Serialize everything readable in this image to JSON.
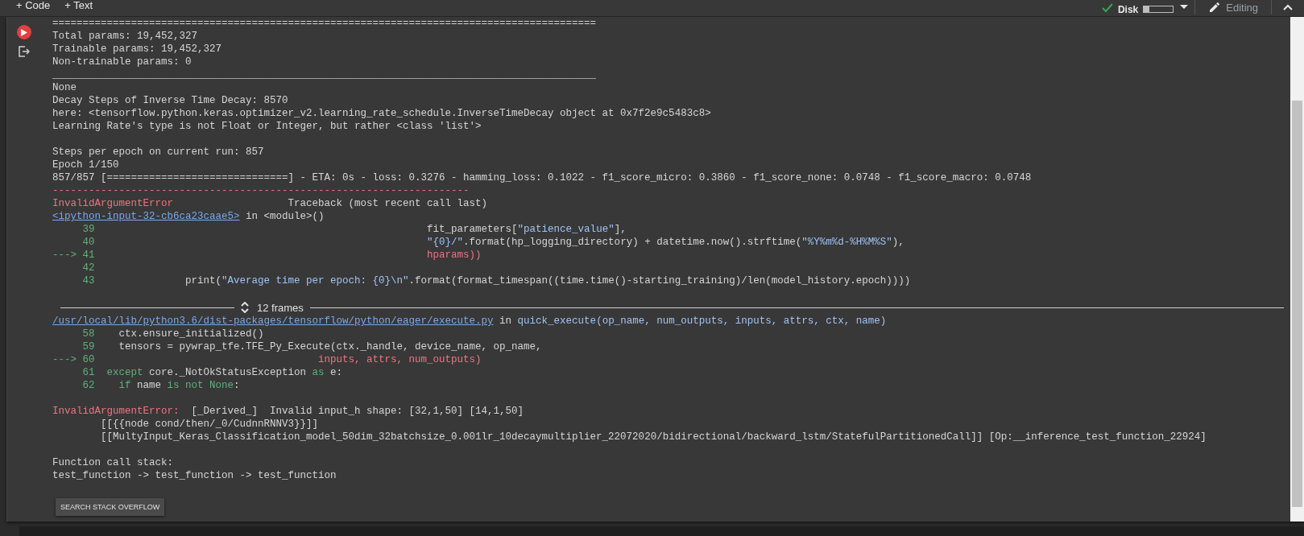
{
  "toolbar": {
    "add_buttons": [
      "+ Code",
      "+ Text"
    ],
    "status": {
      "connected": true,
      "disk": {
        "label": "Disk",
        "level": 0.2
      }
    },
    "mode": {
      "label": "Editing"
    }
  },
  "cell": {
    "output": [
      {
        "kind": "text",
        "segments": [
          {
            "text": "=========================================================================================="
          }
        ]
      },
      {
        "kind": "text",
        "segments": [
          {
            "text": "Total params: 19,452,327"
          }
        ]
      },
      {
        "kind": "text",
        "segments": [
          {
            "text": "Trainable params: 19,452,327"
          }
        ]
      },
      {
        "kind": "text",
        "segments": [
          {
            "text": "Non-trainable params: 0"
          }
        ]
      },
      {
        "kind": "text",
        "segments": [
          {
            "text": "__________________________________________________________________________________________"
          }
        ]
      },
      {
        "kind": "text",
        "segments": [
          {
            "text": "None"
          }
        ]
      },
      {
        "kind": "text",
        "segments": [
          {
            "text": "Decay Steps of Inverse Time Decay: 8570"
          }
        ]
      },
      {
        "kind": "text",
        "segments": [
          {
            "text": "here: <tensorflow.python.keras.optimizer_v2.learning_rate_schedule.InverseTimeDecay object at 0x7f2e9c5483c8>"
          }
        ]
      },
      {
        "kind": "text",
        "segments": [
          {
            "text": "Learning Rate's type is not Float or Integer, but rather <class 'list'>"
          }
        ]
      },
      {
        "kind": "blank"
      },
      {
        "kind": "text",
        "segments": [
          {
            "text": "Steps per epoch on current run: 857"
          }
        ]
      },
      {
        "kind": "text",
        "segments": [
          {
            "text": "Epoch 1/150"
          }
        ]
      },
      {
        "kind": "text",
        "segments": [
          {
            "text": "857/857 [==============================] - ETA: 0s - loss: 0.3276 - hamming_loss: 0.1022 - f1_score_micro: 0.3860 - f1_score_none: 0.0748 - f1_score_macro: 0.0748"
          }
        ]
      },
      {
        "kind": "text",
        "segments": [
          {
            "text": "---------------------------------------------------------------------",
            "kind": "error"
          }
        ]
      },
      {
        "kind": "text",
        "segments": [
          {
            "text": "InvalidArgumentError",
            "kind": "error"
          },
          {
            "text": "                   Traceback (most recent call last)"
          }
        ]
      },
      {
        "kind": "text",
        "segments": [
          {
            "text": "<ipython-input-32-cb6ca23caae5>",
            "kind": "link"
          },
          {
            "text": " in <module>()"
          }
        ]
      },
      {
        "kind": "code",
        "number": "39",
        "segments": [
          {
            "text": "                                                       fit_parameters["
          },
          {
            "text": "\"patience_value\"",
            "kind": "string"
          },
          {
            "text": "],"
          }
        ]
      },
      {
        "kind": "code",
        "number": "40",
        "segments": [
          {
            "text": "                                                       \"{0}/\"",
            "kind": "string"
          },
          {
            "text": ".format(hp_logging_directory) + datetime.now().strftime("
          },
          {
            "text": "\"%Y%m%d-%H%M%S\"",
            "kind": "string"
          },
          {
            "text": "),"
          }
        ]
      },
      {
        "kind": "code",
        "marker": "--->",
        "number": "41",
        "segments": [
          {
            "text": "                                                       hparams))",
            "kind": "error"
          }
        ]
      },
      {
        "kind": "code",
        "number": "42"
      },
      {
        "kind": "code",
        "number": "43",
        "segments": [
          {
            "text": "               print("
          },
          {
            "text": "\"Average time per epoch: {0}\\n\"",
            "kind": "string"
          },
          {
            "text": ".format(format_timespan((time.time()-starting_training)/len(model_history.epoch))))"
          }
        ]
      },
      {
        "kind": "blank"
      },
      {
        "kind": "frames",
        "label": "12 frames"
      },
      {
        "kind": "text",
        "segments": [
          {
            "text": "/usr/local/lib/python3.6/dist-packages/tensorflow/python/eager/execute.py",
            "kind": "link"
          },
          {
            "text": " in "
          },
          {
            "text": "quick_execute(op_name, num_outputs, inputs, attrs, ctx, name)",
            "kind": "call"
          }
        ]
      },
      {
        "kind": "code",
        "number": "58",
        "segments": [
          {
            "text": "    ctx.ensure_initialized()"
          }
        ]
      },
      {
        "kind": "code",
        "number": "59",
        "segments": [
          {
            "text": "    tensors = pywrap_tfe.TFE_Py_Execute(ctx._handle, device_name, op_name,"
          }
        ]
      },
      {
        "kind": "code",
        "marker": "--->",
        "number": "60",
        "segments": [
          {
            "text": "                                     inputs, attrs, num_outputs)",
            "kind": "error"
          }
        ]
      },
      {
        "kind": "code",
        "number": "61",
        "segments": [
          {
            "text": "  except",
            "kind": "keyword"
          },
          {
            "text": " core._NotOkStatusException "
          },
          {
            "text": "as",
            "kind": "keyword"
          },
          {
            "text": " e:"
          }
        ]
      },
      {
        "kind": "code",
        "number": "62",
        "segments": [
          {
            "text": "    if",
            "kind": "keyword"
          },
          {
            "text": " name "
          },
          {
            "text": "is not None",
            "kind": "keyword"
          },
          {
            "text": ":"
          }
        ]
      },
      {
        "kind": "blank"
      },
      {
        "kind": "text",
        "segments": [
          {
            "text": "InvalidArgumentError:",
            "kind": "error"
          },
          {
            "text": "  [_Derived_]  Invalid input_h shape: [32,1,50] [14,1,50]"
          }
        ]
      },
      {
        "kind": "text",
        "segments": [
          {
            "text": "        [[{{node cond/then/_0/CudnnRNNV3}}]]"
          }
        ]
      },
      {
        "kind": "text",
        "segments": [
          {
            "text": "        [[MultyInput_Keras_Classification_model_50dim_32batchsize_0.001lr_10decaymultiplier_22072020/bidirectional/backward_lstm/StatefulPartitionedCall]] [Op:__inference_test_function_22924]"
          }
        ]
      },
      {
        "kind": "blank"
      },
      {
        "kind": "text",
        "segments": [
          {
            "text": "Function call stack:"
          }
        ]
      },
      {
        "kind": "text",
        "segments": [
          {
            "text": "test_function -> test_function -> test_function"
          }
        ]
      }
    ],
    "search_button": "SEARCH STACK OVERFLOW"
  }
}
